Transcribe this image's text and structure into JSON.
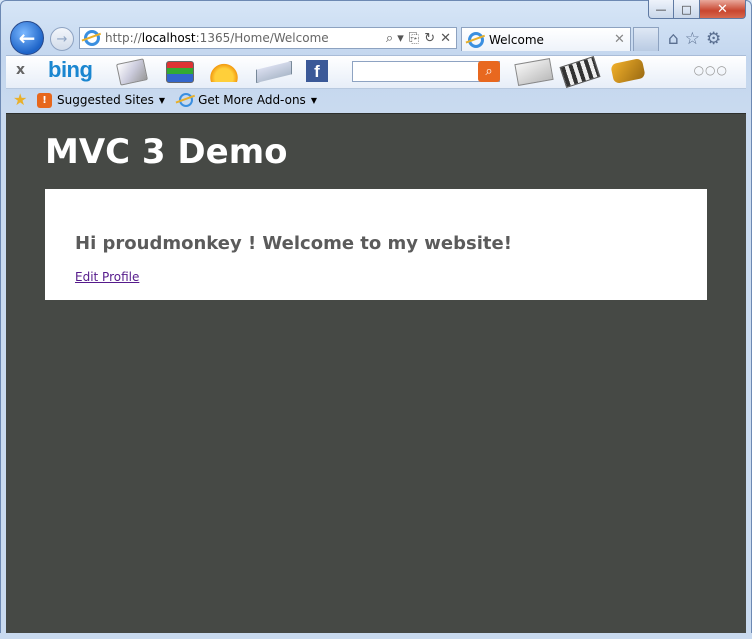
{
  "window": {
    "caption": {
      "minimize": "—",
      "maximize": "□",
      "close": "✕"
    }
  },
  "nav": {
    "back_icon": "arrow-left",
    "forward_icon": "arrow-right",
    "url_prefix": "http://",
    "url_host": "localhost",
    "url_rest": ":1365/Home/Welcome",
    "addr_tools": [
      "⌕ ▾",
      "⎘",
      "↻",
      "✕"
    ]
  },
  "tab": {
    "label": "Welcome",
    "close": "✕"
  },
  "toolbar_icons": {
    "home": "⌂",
    "favorites": "☆",
    "tools": "⚙"
  },
  "bingbar": {
    "close": "x",
    "logo": "bing",
    "search_value": "",
    "search_icon": "⌕",
    "more": "○○○"
  },
  "favbar": {
    "star_icon": "★",
    "suggested_sites": "Suggested Sites",
    "get_more_addons": "Get More Add-ons",
    "caret": "▼"
  },
  "page": {
    "site_title": "MVC 3 Demo",
    "greeting": "Hi proudmonkey ! Welcome to my website!",
    "edit_profile_link": "Edit Profile"
  },
  "colors": {
    "page_background": "#464945",
    "panel_background": "#ffffff",
    "greeting_text": "#5b5b5b",
    "link_visited": "#551a8b"
  }
}
